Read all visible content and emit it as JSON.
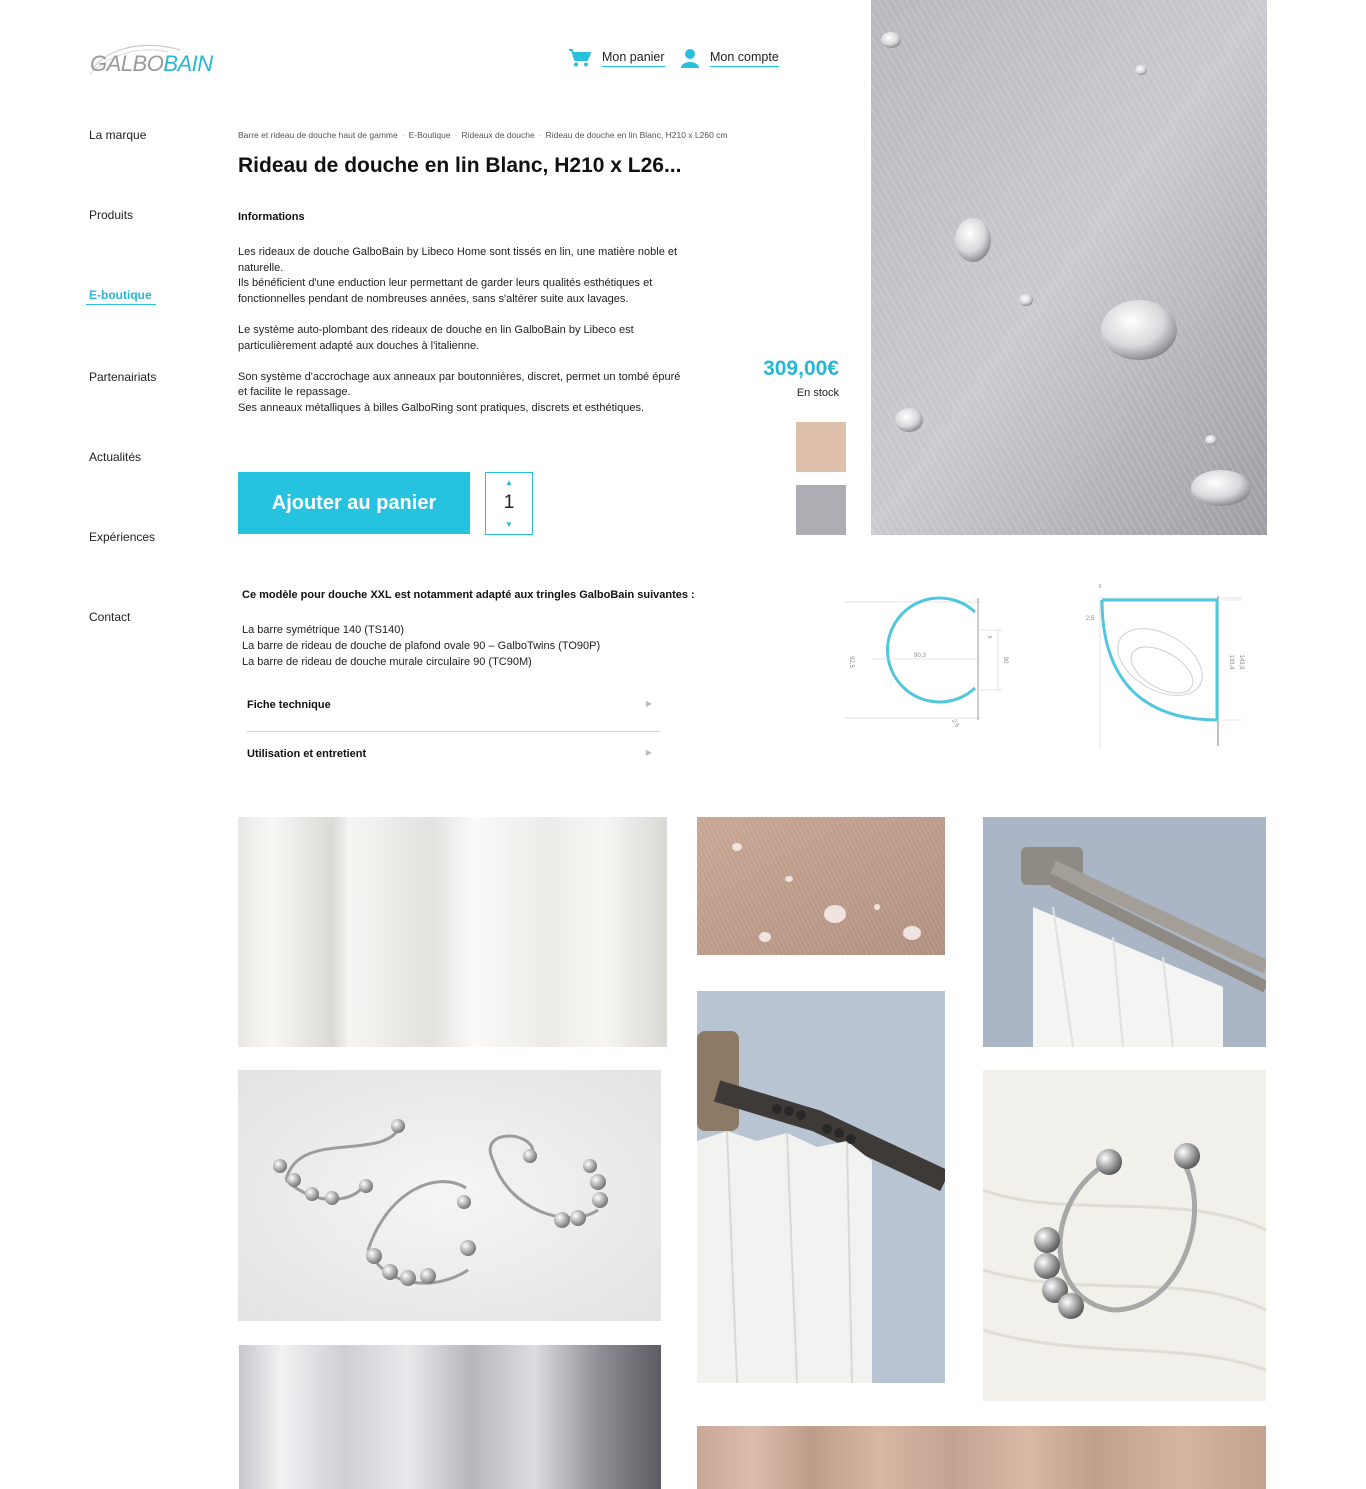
{
  "brand": {
    "part1": "GALBO",
    "part2": "BAIN"
  },
  "header": {
    "cart_label": "Mon panier",
    "account_label": "Mon compte"
  },
  "sidebar": {
    "items": [
      {
        "label": "La marque"
      },
      {
        "label": "Produits"
      },
      {
        "label": "E-boutique"
      },
      {
        "label": "Partenairiats"
      },
      {
        "label": "Actualités"
      },
      {
        "label": "Expériences"
      },
      {
        "label": "Contact"
      }
    ],
    "active_index": 2
  },
  "breadcrumb": [
    "Barre et rideau de douche haut de gamme",
    "E-Boutique",
    "Rideaux de douche",
    "Rideau de douche en lin Blanc, H210 x L260 cm"
  ],
  "product": {
    "title": "Rideau de douche en lin Blanc, H210 x L26...",
    "info_heading": "Informations",
    "description": {
      "p1_l1": "Les rideaux de douche GalboBain by Libeco Home sont tissés en lin, une matière noble et naturelle.",
      "p1_l2": "Ils bénéficient d'une enduction leur permettant de garder leurs qualités esthétiques et fonctionnelles pendant de nombreuses années, sans s'altérer suite aux lavages.",
      "p2": "Le système auto-plombant des rideaux de douche en lin GalboBain by Libeco est particulièrement adapté aux douches à l'italienne.",
      "p3_l1": "Son système d'accrochage aux anneaux par boutonnières, discret, permet un tombé épuré et facilite le repassage.",
      "p3_l2": "Ses anneaux métalliques à billes GalboRing sont pratiques, discrets et esthétiques."
    },
    "price": "309,00€",
    "stock": "En stock",
    "swatches": [
      "#dfc0ac",
      "#aeadb3"
    ],
    "add_to_cart_label": "Ajouter au panier",
    "quantity": "1"
  },
  "compat": {
    "heading": "Ce modèle pour douche XXL est notamment adapté aux tringles GalboBain suivantes :",
    "items": [
      "La barre symétrique 140 (TS140)",
      "La barre de rideau de douche de plafond ovale 90 – GalboTwins (TO90P)",
      "La barre de rideau de douche murale circulaire 90 (TC90M)"
    ]
  },
  "accordions": {
    "tech": "Fiche technique",
    "care": "Utilisation et entretient"
  },
  "diagram1": {
    "dim_left": "92,5",
    "dim_center": "90,3",
    "dim_right": "90",
    "dim_bottom": "2,5",
    "dim_top": "9"
  },
  "diagram2": {
    "dim_top": "9",
    "dim_left": "2,5",
    "dim_right1": "133,4",
    "dim_right2": "143,9"
  },
  "colors": {
    "accent": "#26c3e0",
    "accent_text": "#27b6d4"
  }
}
